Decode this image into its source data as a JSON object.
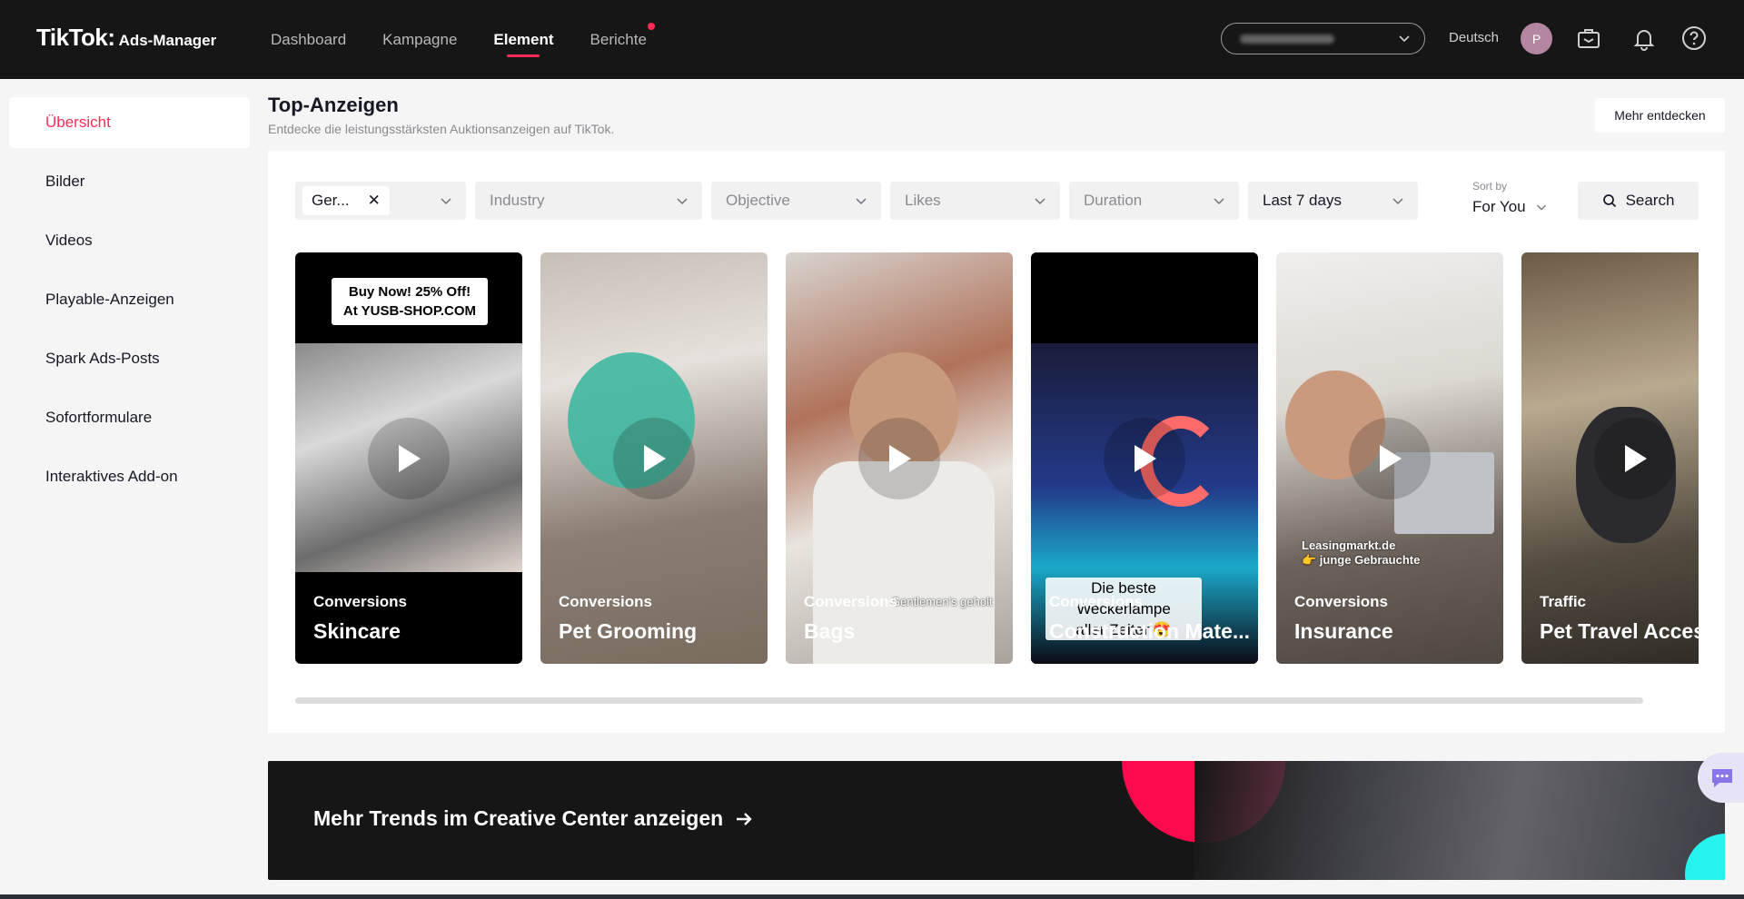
{
  "brand": {
    "logo_main": "TikTok",
    "logo_sep": ":",
    "logo_sub": "Ads-Manager"
  },
  "nav": {
    "items": [
      {
        "label": "Dashboard"
      },
      {
        "label": "Kampagne"
      },
      {
        "label": "Element"
      },
      {
        "label": "Berichte"
      }
    ],
    "active": "Element",
    "notification_dot_on": "Berichte"
  },
  "header_right": {
    "language": "Deutsch",
    "avatar_initial": "P"
  },
  "sidebar": {
    "items": [
      {
        "label": "Übersicht"
      },
      {
        "label": "Bilder"
      },
      {
        "label": "Videos"
      },
      {
        "label": "Playable-Anzeigen"
      },
      {
        "label": "Spark Ads-Posts"
      },
      {
        "label": "Sofortformulare"
      },
      {
        "label": "Interaktives Add-on"
      }
    ],
    "active": "Übersicht"
  },
  "page": {
    "title": "Top-Anzeigen",
    "subtitle": "Entdecke die leistungsstärksten Auktionsanzeigen auf TikTok.",
    "more_button": "Mehr entdecken"
  },
  "filters": {
    "country_chip": "Ger...",
    "industry_placeholder": "Industry",
    "objective_placeholder": "Objective",
    "likes_placeholder": "Likes",
    "duration_placeholder": "Duration",
    "period": "Last 7 days",
    "sort_label": "Sort by",
    "sort_value": "For You",
    "search_button": "Search"
  },
  "cards": [
    {
      "objective": "Conversions",
      "title": "Skincare",
      "overlay": "Buy Now! 25% Off!\nAt YUSB-SHOP.COM"
    },
    {
      "objective": "Conversions",
      "title": "Pet Grooming",
      "overlay": ""
    },
    {
      "objective": "Conversions",
      "title": "Bags",
      "overlay": "Gentlemen's geholt"
    },
    {
      "objective": "Conversions",
      "title": "Construction Mate...",
      "overlay": "Die beste Weckerlampe\naller Zeiten😍"
    },
    {
      "objective": "Conversions",
      "title": "Insurance",
      "overlay": "Leasingmarkt.de\n👉 junge Gebrauchte"
    },
    {
      "objective": "Traffic",
      "title": "Pet Travel Access",
      "overlay": ""
    }
  ],
  "banner": {
    "text": "Mehr Trends im Creative Center anzeigen"
  },
  "colors": {
    "accent": "#fe2c55",
    "topbar": "#161616",
    "banner": "#161616"
  },
  "icons": [
    "chevron-down-icon",
    "briefcase-icon",
    "bell-icon",
    "help-icon",
    "close-icon",
    "search-icon",
    "play-icon",
    "arrow-right-icon",
    "chat-icon"
  ]
}
